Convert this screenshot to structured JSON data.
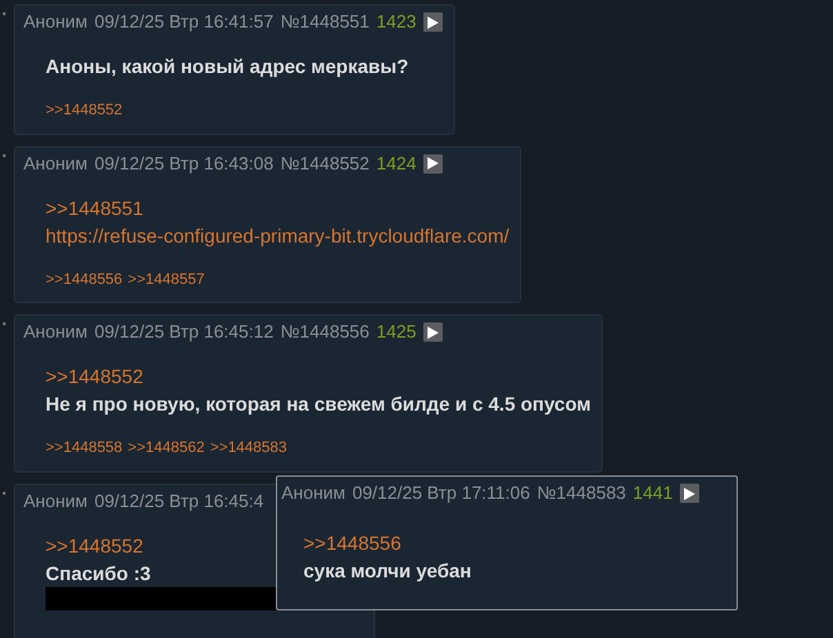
{
  "posts": [
    {
      "name": "Аноним",
      "date": "09/12/25 Втр 16:41:57",
      "num": "№1448551",
      "count": "1423",
      "body": [
        {
          "kind": "text",
          "text": "Аноны, какой новый адрес меркавы?"
        }
      ],
      "replies": [
        ">>1448552"
      ]
    },
    {
      "name": "Аноним",
      "date": "09/12/25 Втр 16:43:08",
      "num": "№1448552",
      "count": "1424",
      "body": [
        {
          "kind": "reply",
          "text": ">>1448551"
        },
        {
          "kind": "link",
          "text": "https://refuse-configured-primary-bit.trycloudflare.com/"
        }
      ],
      "replies": [
        ">>1448556",
        ">>1448557"
      ]
    },
    {
      "name": "Аноним",
      "date": "09/12/25 Втр 16:45:12",
      "num": "№1448556",
      "count": "1425",
      "body": [
        {
          "kind": "reply",
          "text": ">>1448552"
        },
        {
          "kind": "text",
          "text": "Не я про новую, которая на свежем билде и с 4.5 опусом"
        }
      ],
      "replies": [
        ">>1448558",
        ">>1448562",
        ">>1448583"
      ]
    },
    {
      "name": "Аноним",
      "date": "09/12/25 Втр 16:45:4",
      "body": [
        {
          "kind": "reply",
          "text": ">>1448552"
        },
        {
          "kind": "text",
          "text": "Спасибо :3"
        },
        {
          "kind": "spoiler"
        }
      ]
    }
  ],
  "popup": {
    "name": "Аноним",
    "date": "09/12/25 Втр 17:11:06",
    "num": "№1448583",
    "count": "1441",
    "body": [
      {
        "kind": "reply",
        "text": ">>1448556"
      },
      {
        "kind": "text",
        "text": "сука молчи уебан"
      }
    ]
  }
}
